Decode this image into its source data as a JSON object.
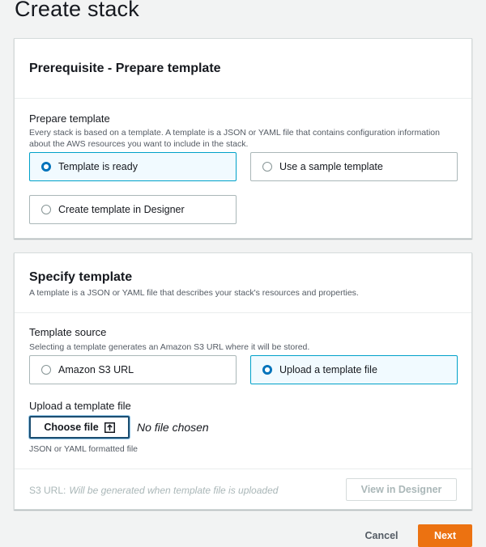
{
  "page": {
    "title": "Create stack"
  },
  "prerequisite": {
    "heading": "Prerequisite - Prepare template",
    "field_label": "Prepare template",
    "field_desc": "Every stack is based on a template. A template is a JSON or YAML file that contains configuration information about the AWS resources you want to include in the stack.",
    "options": [
      {
        "label": "Template is ready",
        "selected": true
      },
      {
        "label": "Use a sample template",
        "selected": false
      },
      {
        "label": "Create template in Designer",
        "selected": false
      }
    ]
  },
  "specify": {
    "heading": "Specify template",
    "desc": "A template is a JSON or YAML file that describes your stack's resources and properties.",
    "source_label": "Template source",
    "source_desc": "Selecting a template generates an Amazon S3 URL where it will be stored.",
    "source_options": [
      {
        "label": "Amazon S3 URL",
        "selected": false
      },
      {
        "label": "Upload a template file",
        "selected": true
      }
    ],
    "upload_label": "Upload a template file",
    "choose_file_label": "Choose file",
    "no_file_text": "No file chosen",
    "file_hint": "JSON or YAML formatted file",
    "s3_url_label": "S3 URL:",
    "s3_url_value": "Will be generated when template file is uploaded",
    "view_designer_label": "View in Designer"
  },
  "footer": {
    "cancel_label": "Cancel",
    "next_label": "Next"
  },
  "colors": {
    "selected_border": "#00a1c9",
    "radio_selected": "#0073bb",
    "primary_button": "#ec7211"
  },
  "icons": {
    "upload": "upload-icon"
  }
}
